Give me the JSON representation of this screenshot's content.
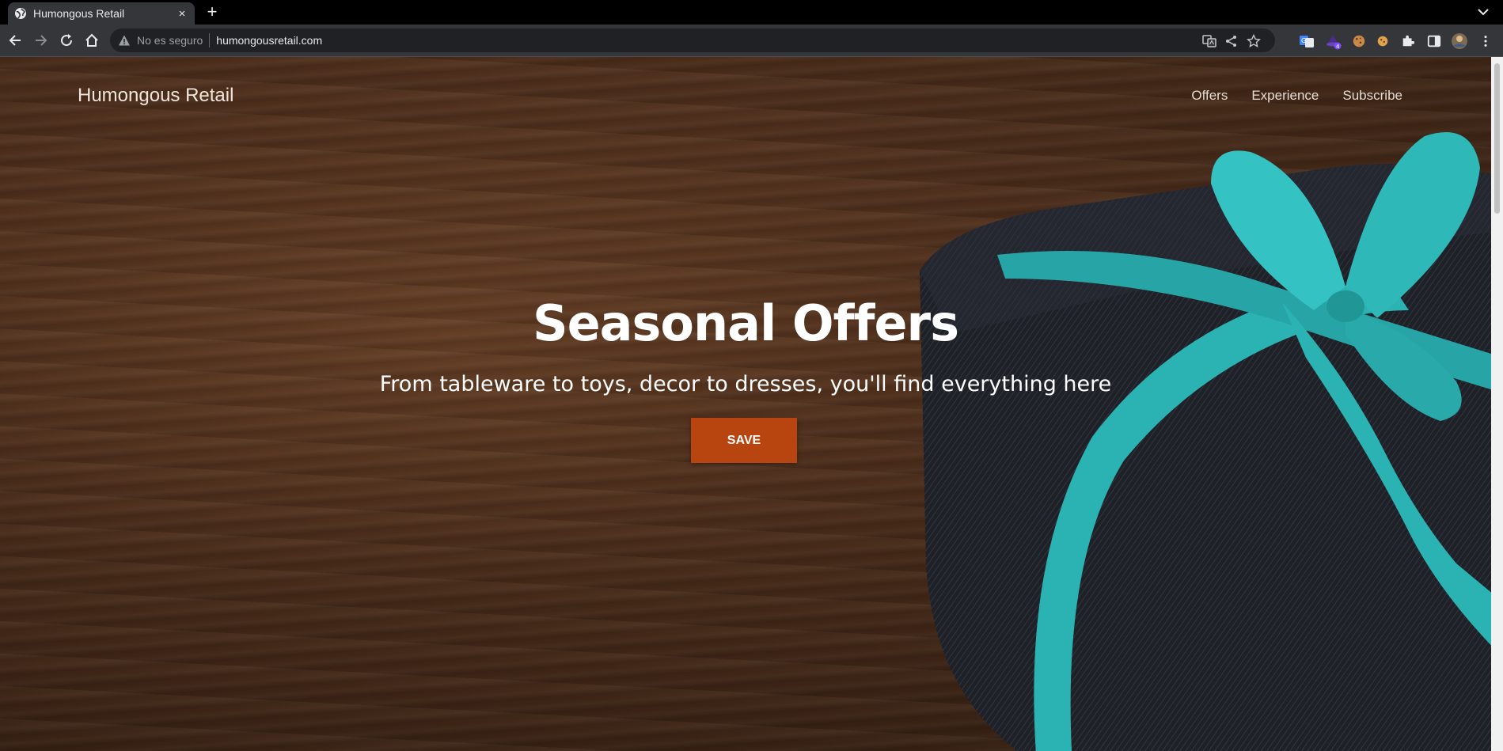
{
  "browser": {
    "tab_title": "Humongous Retail",
    "tab_close": "×",
    "new_tab": "+",
    "security_label": "No es seguro",
    "url": "humongousretail.com",
    "extension_badge_count": "4"
  },
  "site": {
    "brand": "Humongous Retail",
    "nav": [
      "Offers",
      "Experience",
      "Subscribe"
    ]
  },
  "hero": {
    "title": "Seasonal Offers",
    "subtitle": "From tableware to toys, decor to dresses, you'll find everything here",
    "button_label": "SAVE"
  },
  "colors": {
    "cta": "#b8440f",
    "ribbon": "#2bb3b3",
    "chrome_bg": "#35363a"
  }
}
